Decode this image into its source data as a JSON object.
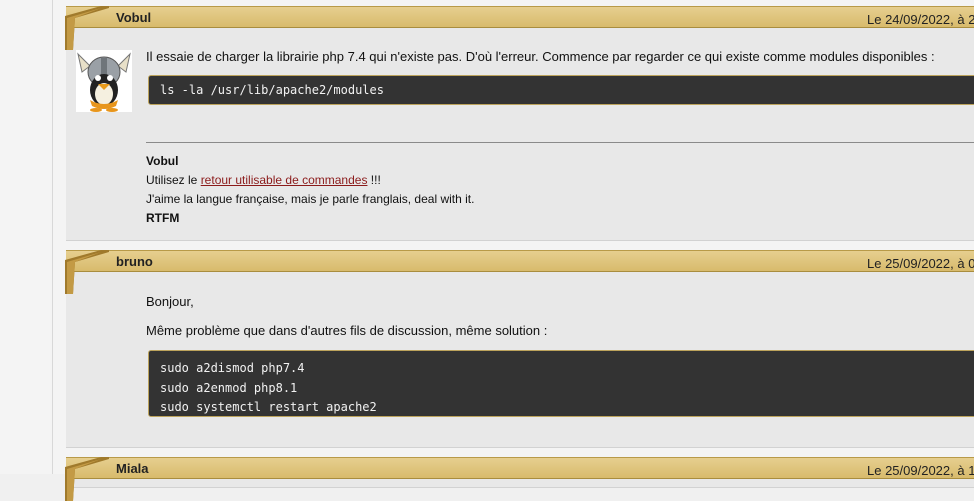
{
  "posts": [
    {
      "author": "Vobul",
      "date": "Le 24/09/2022, à 2",
      "paragraphs": [
        "Il essaie de charger la librairie php 7.4 qui n'existe pas. D'où l'erreur. Commence par regarder ce qui existe comme modules disponibles :"
      ],
      "code": [
        "ls -la /usr/lib/apache2/modules"
      ],
      "signature": {
        "name": "Vobul",
        "line1_prefix": "Utilisez le ",
        "line1_link": "retour utilisable de commandes",
        "line1_suffix": " !!!",
        "line2": "J'aime la langue française, mais je parle franglais, deal with it.",
        "line3": "RTFM"
      }
    },
    {
      "author": "bruno",
      "date": "Le 25/09/2022, à 0",
      "paragraphs": [
        "Bonjour,",
        "Même problème que dans d'autres fils de discussion, même solution :"
      ],
      "code": [
        "sudo a2dismod php7.4",
        "sudo a2enmod php8.1",
        "sudo systemctl restart apache2"
      ]
    },
    {
      "author": "Miala",
      "date": "Le 25/09/2022, à 1"
    }
  ],
  "colors": {
    "header": "#d8bb6c",
    "corner": "#a07a2c",
    "code_bg": "#333333",
    "link": "#8b1a1a"
  },
  "icons": {
    "avatar": "viking-helmet-penguin-avatar"
  }
}
